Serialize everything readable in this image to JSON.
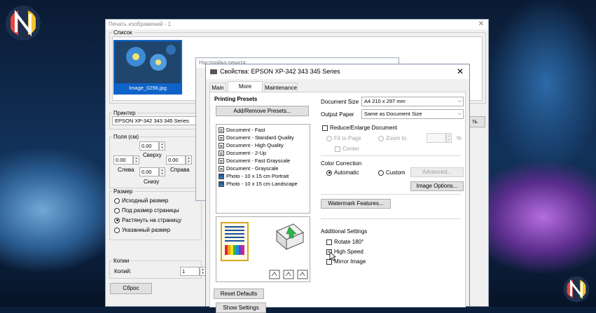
{
  "print_window": {
    "title": "Печать изображений - 1",
    "list_legend": "Список",
    "thumb_caption": "Image_0256.jpg",
    "printer_legend": "Принтер",
    "printer_value": "EPSON XP-342 343 345 Series",
    "right_button_partial": "ть",
    "margins_legend": "Поля (см)",
    "top_label": "Сверху",
    "left_label": "Слева",
    "right_label": "Справа",
    "bottom_label": "Снизу",
    "top_value": "0.00",
    "left_value": "0.00",
    "right_value": "0.00",
    "bottom_value": "0.00",
    "size_legend": "Размер",
    "size_options": [
      "Исходный размер",
      "Под размер страницы",
      "Растянуть на страницу",
      "Указанный размер"
    ],
    "size_selected_index": 2,
    "copies_legend": "Копии",
    "copies_label": "Копий:",
    "copies_value": "1",
    "reset_button": "Сброс"
  },
  "setup_window": {
    "title": "Настройка печати"
  },
  "epson_dialog": {
    "title": "Свойства: EPSON XP-342 343 345 Series",
    "tabs": [
      "Main",
      "More Options",
      "Maintenance"
    ],
    "active_tab_index": 1,
    "printing_presets_label": "Printing Presets",
    "add_remove_presets": "Add/Remove Presets...",
    "presets": [
      {
        "label": "Document - Fast",
        "icon": "document"
      },
      {
        "label": "Document - Standard Quality",
        "icon": "document"
      },
      {
        "label": "Document - High Quality",
        "icon": "document"
      },
      {
        "label": "Document - 2-Up",
        "icon": "document-2up"
      },
      {
        "label": "Document - Fast Grayscale",
        "icon": "document"
      },
      {
        "label": "Document - Grayscale",
        "icon": "document"
      },
      {
        "label": "Photo - 10 x 15 cm Portrait",
        "icon": "photo"
      },
      {
        "label": "Photo - 10 x 15 cm Landscape",
        "icon": "photo"
      }
    ],
    "document_size_label": "Document Size",
    "document_size_value": "A4 210 x 297 mm",
    "output_paper_label": "Output Paper",
    "output_paper_value": "Same as Document Size",
    "reduce_enlarge_label": "Reduce/Enlarge Document",
    "fit_to_page": "Fit to Page",
    "zoom_to": "Zoom to",
    "percent": "%",
    "center": "Center",
    "color_correction_label": "Color Correction",
    "automatic": "Automatic",
    "custom": "Custom",
    "advanced_button": "Advanced...",
    "image_options_button": "Image Options...",
    "watermark_button": "Watermark Features...",
    "additional_settings_label": "Additional Settings",
    "rotate_180": "Rotate 180°",
    "high_speed": "High Speed",
    "mirror_image": "Mirror Image",
    "show_settings": "Show Settings",
    "reset_defaults": "Reset Defaults"
  },
  "colors": {
    "thumb_border": "#1f5fa8",
    "selection_blue": "#0e63c9"
  }
}
